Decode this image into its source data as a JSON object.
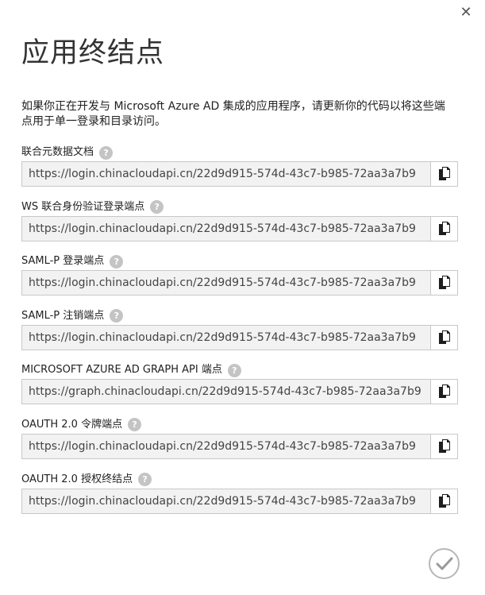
{
  "dialog": {
    "title": "应用终结点",
    "close_icon": "close-icon",
    "description": "如果你正在开发与 Microsoft Azure AD 集成的应用程序，请更新你的代码以将这些端点用于单一登录和目录访问。",
    "help_glyph": "?",
    "confirm_icon": "checkmark-icon"
  },
  "endpoints": [
    {
      "label": "联合元数据文档",
      "url": "https://login.chinacloudapi.cn/22d9d915-574d-43c7-b985-72aa3a7b9"
    },
    {
      "label": "WS 联合身份验证登录端点",
      "url": "https://login.chinacloudapi.cn/22d9d915-574d-43c7-b985-72aa3a7b9"
    },
    {
      "label": "SAML-P 登录端点",
      "url": "https://login.chinacloudapi.cn/22d9d915-574d-43c7-b985-72aa3a7b9"
    },
    {
      "label": "SAML-P 注销端点",
      "url": "https://login.chinacloudapi.cn/22d9d915-574d-43c7-b985-72aa3a7b9"
    },
    {
      "label": "MICROSOFT AZURE AD GRAPH API 端点",
      "url": "https://graph.chinacloudapi.cn/22d9d915-574d-43c7-b985-72aa3a7b9"
    },
    {
      "label": "OAUTH 2.0 令牌端点",
      "url": "https://login.chinacloudapi.cn/22d9d915-574d-43c7-b985-72aa3a7b9"
    },
    {
      "label": "OAUTH 2.0 授权终结点",
      "url": "https://login.chinacloudapi.cn/22d9d915-574d-43c7-b985-72aa3a7b9"
    }
  ],
  "colors": {
    "accent": "#000000",
    "field_bg": "#f2f2f2",
    "border": "#c8c8c8",
    "help": "#c4c4c4"
  }
}
